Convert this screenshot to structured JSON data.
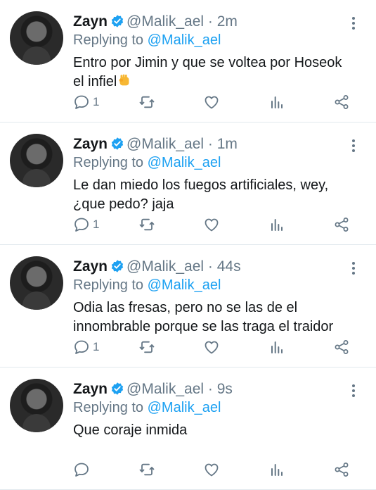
{
  "colors": {
    "accent": "#1da1f2",
    "secondary": "#657786",
    "text": "#14171a",
    "divider": "#e1e8ed"
  },
  "tweets": [
    {
      "name": "Zayn",
      "handle": "@Malik_ael",
      "separator": "·",
      "time": "2m",
      "replying_label": "Replying to",
      "replying_target": "@Malik_ael",
      "text_lines": [
        "Entro por Jimin y que se voltea por Hoseok",
        "el infiel"
      ],
      "emoji": "raised-fist-emoji",
      "reply_count": "1"
    },
    {
      "name": "Zayn",
      "handle": "@Malik_ael",
      "separator": "·",
      "time": "1m",
      "replying_label": "Replying to",
      "replying_target": "@Malik_ael",
      "text_lines": [
        "Le dan miedo los fuegos artificiales, wey,",
        "¿que pedo? jaja"
      ],
      "reply_count": "1"
    },
    {
      "name": "Zayn",
      "handle": "@Malik_ael",
      "separator": "·",
      "time": "44s",
      "replying_label": "Replying to",
      "replying_target": "@Malik_ael",
      "text_lines": [
        "Odia las fresas, pero no se las de el",
        "innombrable porque se las traga el traidor"
      ],
      "reply_count": "1"
    },
    {
      "name": "Zayn",
      "handle": "@Malik_ael",
      "separator": "·",
      "time": "9s",
      "replying_label": "Replying to",
      "replying_target": "@Malik_ael",
      "text_lines": [
        "Que coraje inmida"
      ],
      "reply_count": ""
    }
  ]
}
